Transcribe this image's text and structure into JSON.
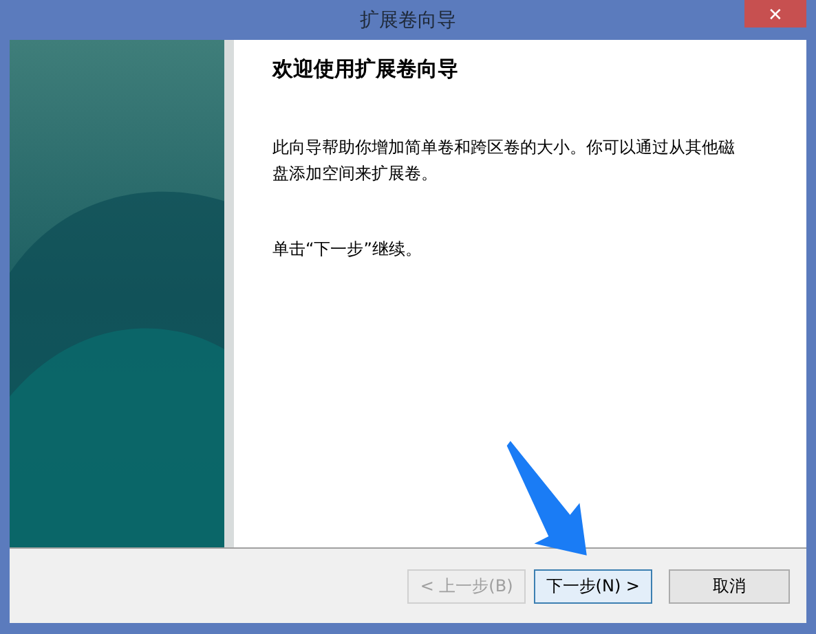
{
  "window": {
    "title": "扩展卷向导",
    "close": "✕"
  },
  "heading": "欢迎使用扩展卷向导",
  "paragraphs": [
    "此向导帮助你增加简单卷和跨区卷的大小。你可以通过从其他磁盘添加空间来扩展卷。",
    "单击“下一步”继续。"
  ],
  "buttons": [
    {
      "label": "< 上一步(B)",
      "disabled": true,
      "selected": false
    },
    {
      "label": "下一步(N)  >",
      "disabled": false,
      "selected": true
    },
    {
      "label": "取消",
      "disabled": false,
      "selected": false
    }
  ]
}
